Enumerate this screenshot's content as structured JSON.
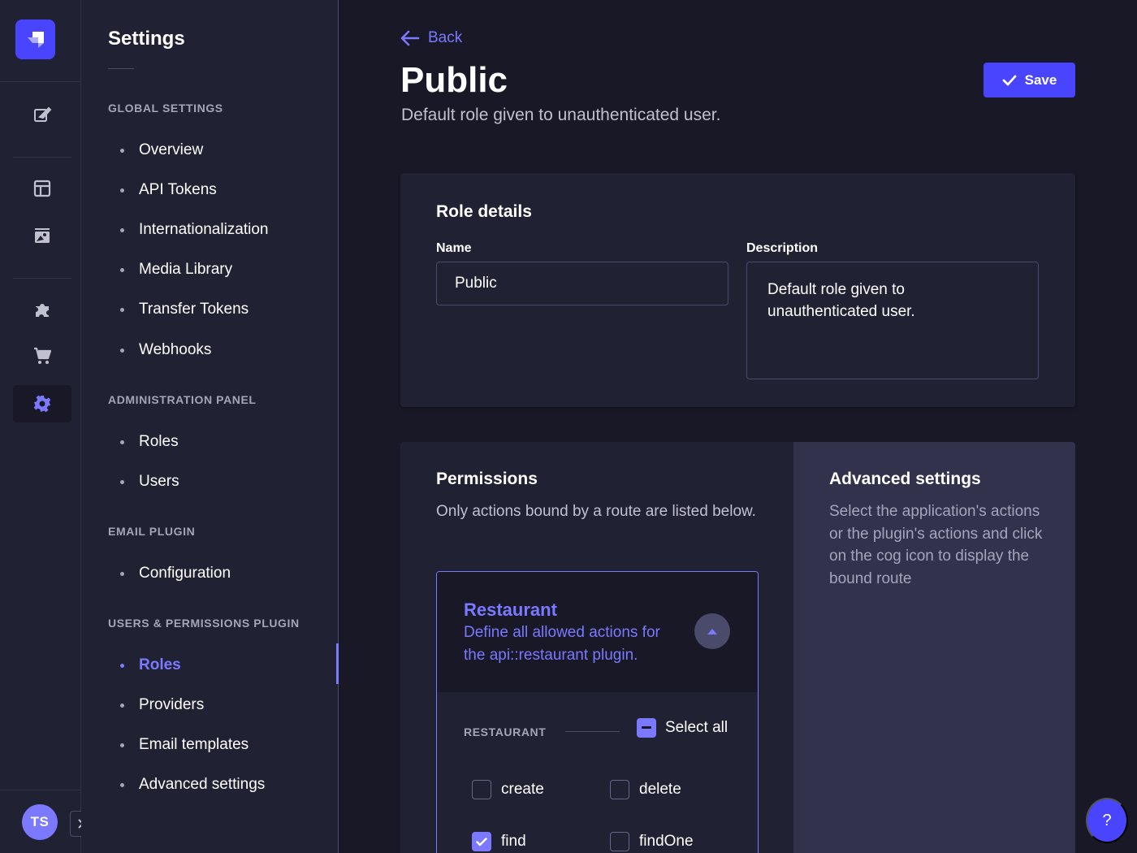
{
  "user": {
    "initials": "TS"
  },
  "subnav": {
    "title": "Settings",
    "sections": [
      {
        "label": "Global Settings",
        "items": [
          {
            "label": "Overview"
          },
          {
            "label": "API Tokens"
          },
          {
            "label": "Internationalization"
          },
          {
            "label": "Media Library"
          },
          {
            "label": "Transfer Tokens"
          },
          {
            "label": "Webhooks"
          }
        ]
      },
      {
        "label": "Administration Panel",
        "items": [
          {
            "label": "Roles"
          },
          {
            "label": "Users"
          }
        ]
      },
      {
        "label": "Email Plugin",
        "items": [
          {
            "label": "Configuration"
          }
        ]
      },
      {
        "label": "Users & Permissions Plugin",
        "items": [
          {
            "label": "Roles",
            "active": true
          },
          {
            "label": "Providers"
          },
          {
            "label": "Email templates"
          },
          {
            "label": "Advanced settings"
          }
        ]
      }
    ]
  },
  "header": {
    "back_label": "Back",
    "title": "Public",
    "subtitle": "Default role given to unauthenticated user.",
    "save_label": "Save"
  },
  "role_details": {
    "title": "Role details",
    "name_label": "Name",
    "name_value": "Public",
    "description_label": "Description",
    "description_value": "Default role given to unauthenticated user."
  },
  "permissions": {
    "title": "Permissions",
    "description": "Only actions bound by a route are listed below.",
    "accordion": {
      "title": "Restaurant",
      "subtitle": "Define all allowed actions for the api::restaurant plugin.",
      "section_label": "RESTAURANT",
      "select_all_label": "Select all",
      "actions": [
        {
          "label": "create",
          "checked": false
        },
        {
          "label": "delete",
          "checked": false
        },
        {
          "label": "find",
          "checked": true
        },
        {
          "label": "findOne",
          "checked": false
        }
      ]
    }
  },
  "advanced": {
    "title": "Advanced settings",
    "description": "Select the application's actions or the plugin's actions and click on the cog icon to display the bound route"
  },
  "help": {
    "label": "?"
  },
  "colors": {
    "accent": "#4945ff",
    "accent_light": "#7b79ff",
    "background": "#181826",
    "surface": "#212134"
  }
}
